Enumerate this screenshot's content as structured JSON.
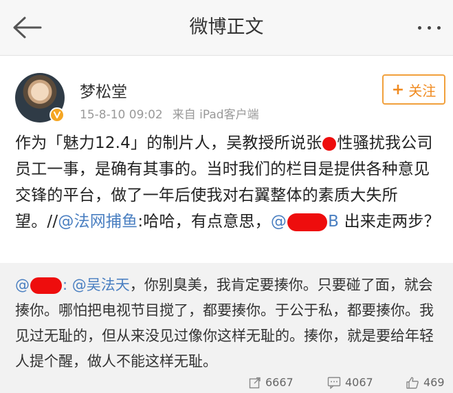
{
  "header": {
    "title": "微博正文",
    "back_icon": "back-arrow-icon",
    "more_icon": "more-dots-icon"
  },
  "author": {
    "name": "梦松堂",
    "verified_badge_color": "#f5a623",
    "time": "15-8-10 09:02",
    "source": "来自 iPad客户端",
    "follow_label": "关注",
    "follow_color": "#f08b21"
  },
  "post": {
    "text_part1": "作为「魅力12.4」的制片人，吴教授所说张",
    "text_part2": "性骚扰我公司员工一事，是确有其事的。当时我们的栏目是提供各种意见交锋的平台，做了一年后使我对右翼整体的素质大失所望。//",
    "mention1": "@法网捕鱼",
    "text_part3": ":哈哈，有点意思，",
    "mention2": "@",
    "mention2_tail": "B",
    "text_part4": " 出来走两步？"
  },
  "repost": {
    "mention_prefix": "@",
    "colon": ":",
    "mention": "@吴法天",
    "text": "，你别臭美，我肯定要揍你。只要碰了面，就会揍你。哪怕把电视节目搅了，都要揍你。于公于私，都要揍你。我见过无耻的，但从来没见过像你这样无耻的。揍你，就是要给年轻人提个醒，做人不能这样无耻。"
  },
  "stats": {
    "reposts": "6667",
    "comments": "4067",
    "likes": "469"
  },
  "colors": {
    "link": "#4a7fc1",
    "redaction": "#ee0d0d"
  }
}
